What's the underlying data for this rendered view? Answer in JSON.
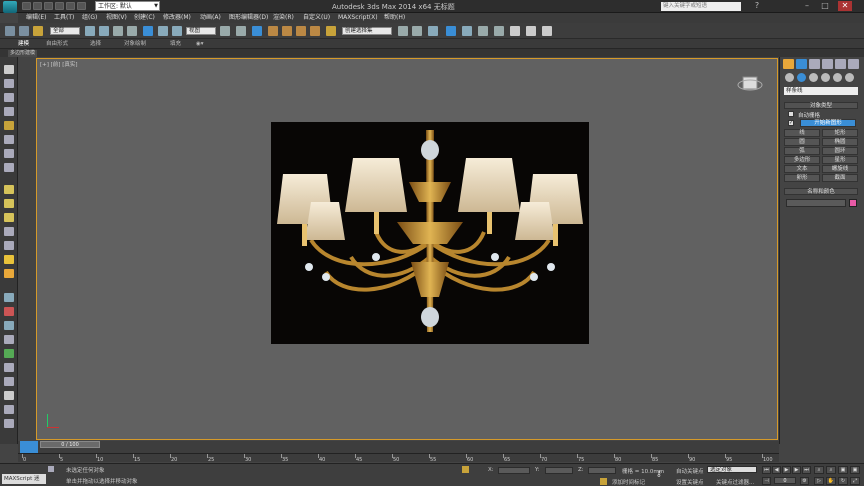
{
  "titlebar": {
    "workspace": "工作区: 默认",
    "title": "Autodesk 3ds Max  2014 x64     无标题",
    "search_placeholder": "键入关键字或短语"
  },
  "menu": [
    "编辑(E)",
    "工具(T)",
    "组(G)",
    "视图(V)",
    "创建(C)",
    "修改器(M)",
    "动画(A)",
    "图形编辑器(D)",
    "渲染(R)",
    "自定义(U)",
    "MAXScript(X)",
    "帮助(H)"
  ],
  "toolbar": {
    "selection_filter": "全部",
    "view_dropdown": "视图",
    "named_selection": "创建选择集"
  },
  "ribbon": {
    "tabs": [
      "建模",
      "自由形式",
      "选择",
      "对象绘制",
      "填充"
    ],
    "sub_tab": "多边形建模"
  },
  "viewport": {
    "label": "[+] [前] [真实]"
  },
  "command_panel": {
    "category": "样条线",
    "rollout_object_type": "对象类型",
    "auto_grid": "自动栅格",
    "start_new_shape": "开始新图形",
    "shapes": [
      "线",
      "矩形",
      "圆",
      "椭圆",
      "弧",
      "圆环",
      "多边形",
      "星形",
      "文本",
      "螺旋线",
      "卵形",
      "截面"
    ],
    "rollout_name_color": "名称和颜色",
    "object_color": "#e85aa6"
  },
  "timeline": {
    "slider": "0 / 100",
    "ticks": [
      "0",
      "5",
      "10",
      "15",
      "20",
      "25",
      "30",
      "35",
      "40",
      "45",
      "50",
      "55",
      "60",
      "65",
      "70",
      "75",
      "80",
      "85",
      "90",
      "95",
      "100"
    ]
  },
  "status": {
    "script_label": "MAXScript 迷",
    "line1": "未选定任何对象",
    "line2": "单击并拖动以选择并移动对象",
    "x_label": "X:",
    "y_label": "Y:",
    "z_label": "Z:",
    "grid": "栅格 = 10.0mm",
    "add_time_tag": "添加时间标记",
    "auto_key": "自动关键点",
    "set_key": "设置关键点",
    "selected_object": "选定对象",
    "key_filters": "关键点过滤器...",
    "frame": "0"
  },
  "colors": {
    "viewport_border": "#d59a2a",
    "accent_blue": "#3a8ed6"
  }
}
